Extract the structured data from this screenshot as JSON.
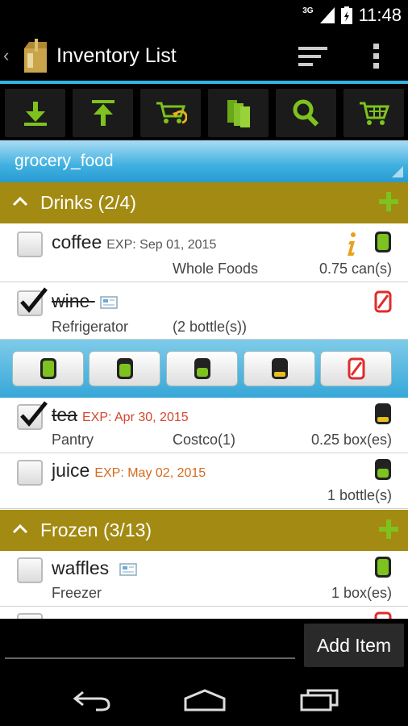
{
  "status_bar": {
    "network": "3G",
    "time": "11:48"
  },
  "action_bar": {
    "title": "Inventory List"
  },
  "toolbar": {
    "buttons": [
      "import-down-icon",
      "export-up-icon",
      "cart-sync-icon",
      "copy-icon",
      "search-icon",
      "cart-icon"
    ]
  },
  "category": {
    "selected": "grocery_food"
  },
  "groups": [
    {
      "title": "Drinks (2/4)"
    },
    {
      "title": "Frozen (3/13)"
    }
  ],
  "items": [
    {
      "name": "coffee",
      "checked": false,
      "exp": "EXP: Sep 01, 2015",
      "store": "Whole Foods",
      "qty": "0.75 can(s)",
      "status": "full"
    },
    {
      "name": "wine",
      "checked": true,
      "location": "Refrigerator",
      "qty": "(2 bottle(s))",
      "status": "none"
    },
    {
      "name": "tea",
      "checked": true,
      "exp": "EXP: Apr 30, 2015",
      "location": "Pantry",
      "store": "Costco(1)",
      "qty": "0.25 box(es)",
      "status": "low"
    },
    {
      "name": "juice",
      "checked": false,
      "exp": "EXP: May 02, 2015",
      "qty": "1 bottle(s)",
      "status": "half"
    },
    {
      "name": "waffles",
      "checked": false,
      "location": "Freezer",
      "qty": "1 box(es)",
      "status": "full"
    }
  ],
  "quick_levels": [
    "full",
    "three-quarter",
    "half",
    "low",
    "none"
  ],
  "bottom": {
    "input_value": "",
    "add_label": "Add Item"
  },
  "colors": {
    "accent": "#33b5e5",
    "group_header": "#a38a12",
    "green": "#7dc21e",
    "red": "#e02b2b"
  }
}
